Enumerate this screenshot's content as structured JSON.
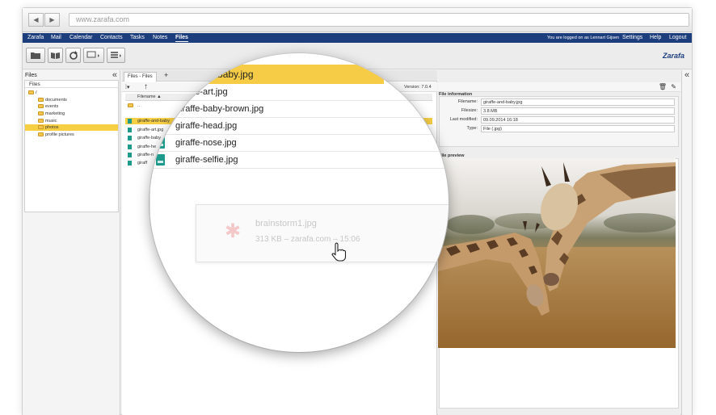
{
  "browser": {
    "address": "www.zarafa.com",
    "back_icon": "◀",
    "forward_icon": "▶"
  },
  "topnav": {
    "items": [
      "Zarafa",
      "Mail",
      "Calendar",
      "Contacts",
      "Tasks",
      "Notes",
      "Files"
    ],
    "active": "Files",
    "logged_in": "You are logged on as Lennart Gijsen",
    "settings": "Settings",
    "help": "Help",
    "logout": "Logout"
  },
  "logo": "Zarafa",
  "left": {
    "title": "Files",
    "collapse": "«",
    "tree_header": "Files",
    "nodes": [
      "/",
      "documents",
      "events",
      "marketing",
      "music",
      "photos",
      "profile pictures"
    ],
    "selected": "photos"
  },
  "middle": {
    "tab_label": "Files - Files",
    "add_tab": "+",
    "version": "Version: 7.0.4",
    "column_filename": "Filename ▲",
    "up_row": "..",
    "rows": [
      "giraffe-and-baby",
      "giraffe-art.jpg",
      "giraffe-baby",
      "giraffe-he",
      "giraffe-n",
      "giraff"
    ]
  },
  "lens": {
    "selected": "and-baby.jpg",
    "rows": [
      "giraffe-art.jpg",
      "giraffe-baby-brown.jpg",
      "giraffe-head.jpg",
      "giraffe-nose.jpg",
      "giraffe-selfie.jpg"
    ],
    "drag_name": "brainstorm1.jpg",
    "drag_meta": "313 KB – zarafa.com – 15:06"
  },
  "info": {
    "section": "File information",
    "labels": {
      "filename": "Filename:",
      "filesize": "Filesize:",
      "modified": "Last modified:",
      "type": "Type:"
    },
    "values": {
      "filename": "giraffe-and-baby.jpg",
      "filesize": "3.8 MB",
      "modified": "09.09.2014 16:18",
      "type": "File (.jpg)"
    }
  },
  "preview": {
    "section": "File preview"
  },
  "colors": {
    "nav": "#1d3e7c",
    "selection": "#f7cf45",
    "file_icon": "#1e9a8d"
  }
}
